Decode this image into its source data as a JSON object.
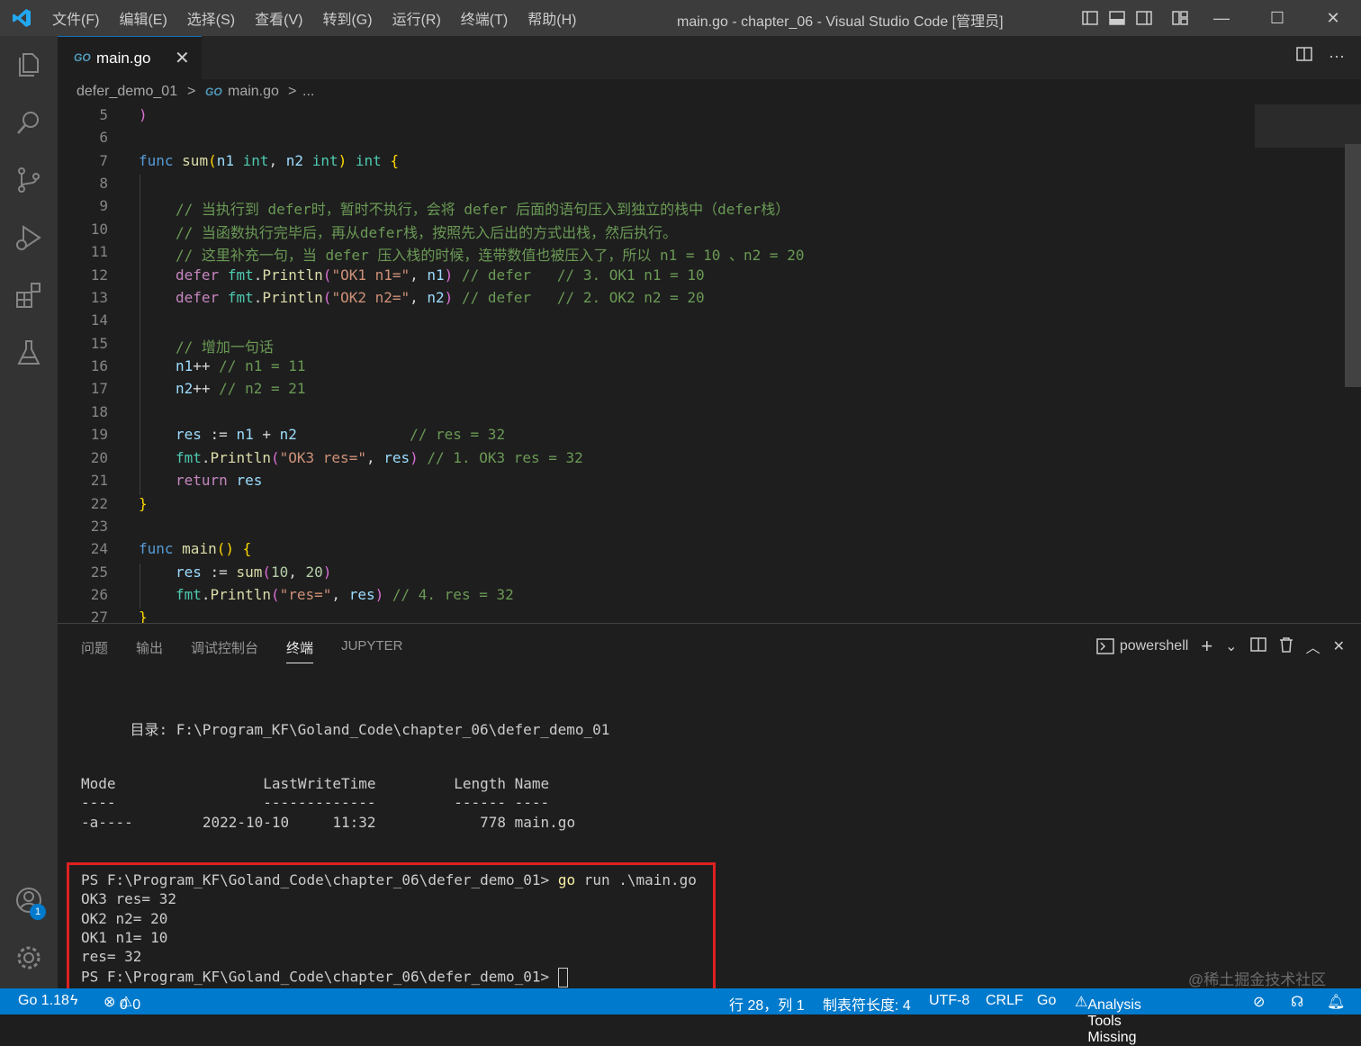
{
  "titlebar": {
    "menus": [
      "文件(F)",
      "编辑(E)",
      "选择(S)",
      "查看(V)",
      "转到(G)",
      "运行(R)",
      "终端(T)",
      "帮助(H)"
    ],
    "title": "main.go - chapter_06 - Visual Studio Code [管理员]"
  },
  "tabs": {
    "go_badge": "GO",
    "active_tab": "main.go"
  },
  "breadcrumb": {
    "folder": "defer_demo_01",
    "file": "main.go",
    "ellipsis": "..."
  },
  "editor": {
    "line_numbers": [
      "5",
      "6",
      "7",
      "8",
      "9",
      "10",
      "11",
      "12",
      "13",
      "14",
      "15",
      "16",
      "17",
      "18",
      "19",
      "20",
      "21",
      "22",
      "23",
      "24",
      "25",
      "26",
      "27"
    ],
    "comment9": "// 当执行到 defer时，暂时不执行，会将 defer 后面的语句压入到独立的栈中（defer栈）",
    "comment10": "// 当函数执行完毕后，再从defer栈，按照先入后出的方式出栈，然后执行。",
    "comment11": "// 这里补充一句，当 defer 压入栈的时候，连带数值也被压入了，所以 n1 = 10 、n2 = 20",
    "comment15": "// 增加一句话"
  },
  "panel": {
    "tabs": [
      "问题",
      "输出",
      "调试控制台",
      "终端",
      "JUPYTER"
    ],
    "shell": "powershell",
    "terminal_lines": [
      "    目录: F:\\Program_KF\\Goland_Code\\chapter_06\\defer_demo_01",
      "Mode                 LastWriteTime         Length Name",
      "----                 -------------         ------ ----",
      "-a----        2022-10-10     11:32            778 main.go",
      "PS F:\\Program_KF\\Goland_Code\\chapter_06\\defer_demo_01> ",
      "OK3 res= 32",
      "OK2 n2= 20",
      "OK1 n1= 10",
      "res= 32",
      "PS F:\\Program_KF\\Goland_Code\\chapter_06\\defer_demo_01> "
    ],
    "cmd_go": "go",
    "cmd_rest": " run .\\main.go"
  },
  "statusbar": {
    "go_version": "Go 1.18",
    "errors": "0",
    "warnings": "0",
    "position": "行 28，列 1",
    "tab_size": "制表符长度: 4",
    "encoding": "UTF-8",
    "eol": "CRLF",
    "language": "Go",
    "analysis": "Analysis Tools Missing"
  },
  "activity": {
    "accounts_badge": "1"
  },
  "watermark": "@稀土掘金技术社区",
  "colors": {
    "accent": "#007acc",
    "highlight_box": "#e02020"
  }
}
